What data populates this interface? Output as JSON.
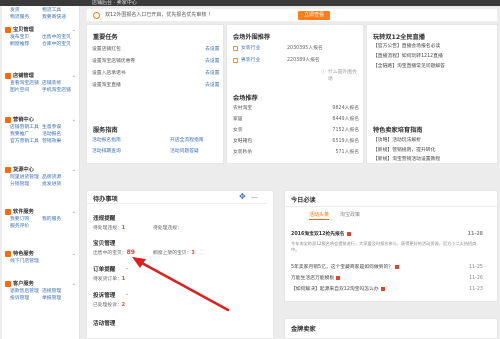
{
  "topbar": {
    "title": "店铺后台 · 卖家中心"
  },
  "sidebar": {
    "top_rows": [
      [
        "发货",
        "物流工具"
      ],
      [
        "物流服务",
        "我要寄快递"
      ]
    ],
    "groups": [
      {
        "title": "宝贝管理",
        "rows": [
          [
            "发布宝贝",
            "出售中的宝贝"
          ],
          [
            "橱窗推荐",
            "仓库中的宝贝"
          ]
        ]
      },
      {
        "title": "店铺管理",
        "rows": [
          [
            "查看淘宝店铺",
            "店铺装修"
          ],
          [
            "图片空间",
            "手机淘宝店铺"
          ]
        ]
      },
      {
        "title": "营销中心",
        "rows": [
          [
            "店铺营销工具",
            "生意参谋"
          ],
          [
            "我要推广",
            "活动报名"
          ],
          [
            "官方营销工具",
            "营销效果"
          ]
        ]
      },
      {
        "title": "货源中心",
        "rows": [
          [
            "阿里进货管理",
            "品牌货源"
          ],
          [
            "分销管理",
            "批发进货"
          ]
        ]
      },
      {
        "title": "软件服务",
        "rows": [
          [
            "我要订购",
            "我的服务"
          ],
          [
            "服务评价",
            ""
          ]
        ]
      },
      {
        "title": "特色服务",
        "rows": [
          [
            "线下门店管理",
            ""
          ]
        ]
      },
      {
        "title": "客户服务",
        "rows": [
          [
            "退款售后管理",
            "违规管理"
          ],
          [
            "投诉管理",
            "举报管理"
          ]
        ]
      }
    ]
  },
  "notice": {
    "text": "双12外围报名入口已开启，优先报名优先审核 ！",
    "button": "立即查看"
  },
  "tasks": {
    "title": "重要任务",
    "rows": [
      {
        "label": "设置店铺红包",
        "link": "去设置"
      },
      {
        "label": "设置淘宝店铺优惠券",
        "link": "去设置"
      },
      {
        "label": "设置入店承诺书",
        "link": "去设置"
      },
      {
        "label": "设置淘宝直播",
        "link": "去设置"
      }
    ]
  },
  "service": {
    "title": "服务指南",
    "rows": [
      {
        "left": "活动报名指南",
        "right": "开店全流程指南"
      },
      {
        "left": "活动排期查询",
        "right": "活动问题答疑"
      }
    ]
  },
  "venue": {
    "title": "会场外围推荐",
    "rows": [
      {
        "name": "女装行业",
        "count": "2030395人报名",
        "cat": ""
      },
      {
        "name": "男装行业",
        "count": "220389人报名",
        "cat": ""
      }
    ],
    "more": "什么是外围会场"
  },
  "venue_rec": {
    "title": "会场推荐",
    "rows": [
      {
        "name": "农村淘宝",
        "value": "9824人报名"
      },
      {
        "name": "家居",
        "value": "8449人报名"
      },
      {
        "name": "女装",
        "value": "7152人报名"
      },
      {
        "name": "女鞋箱包",
        "value": "6519人报名"
      },
      {
        "name": "女装秒杀",
        "value": "571人报名"
      }
    ]
  },
  "live": {
    "title": "玩转双12全民直播",
    "rows": [
      "【官方公告】直播会场报名必读",
      "【直播流程】如何玩转1212直播",
      "【全链路】淘宝直播常见问题解答"
    ]
  },
  "special": {
    "title": "特色卖家培育指南",
    "rows": [
      "【攻略】活动玩法解析",
      "【新规】营销规则，提升转化",
      "【新规】淘宝营销活动设置教程"
    ]
  },
  "todo": {
    "title": "待办事项",
    "sections": [
      {
        "title": "违规提醒",
        "items": [
          {
            "label": "待处理违规：",
            "value": "1"
          },
          {
            "label": "待处理违规：",
            "value": ""
          }
        ]
      },
      {
        "title": "宝贝管理",
        "items": [
          {
            "label": "出售中的宝贝：",
            "value": "89"
          },
          {
            "label": "橱窗上架的宝贝：",
            "value": "3"
          }
        ]
      },
      {
        "title": "订单提醒",
        "items": [
          {
            "label": "待发货订单：",
            "value": "1"
          }
        ]
      },
      {
        "title": "投诉管理",
        "items": [
          {
            "label": "已处理投诉：",
            "value": "2"
          }
        ]
      },
      {
        "title": "活动管理",
        "items": []
      }
    ]
  },
  "news": {
    "title": "今日必读",
    "tabs": [
      "活动头条",
      "淘宝政策"
    ],
    "headline": "2016淘宝双12抢先报名",
    "headline_date": "11-28",
    "summary": "今年淘宝的双12报名将会提前进行，大家要及时报名参与，获得更好的活动资源，官方小二火热招商中。",
    "rows": [
      {
        "text": "5年卖家月销5亿，这个宝藏商家是如何做到的？",
        "date": "11-25"
      },
      {
        "text": "万能生活店万能模板",
        "date": "11-26"
      },
      {
        "text": "【如何解决】起源来自双12淘宝吗怎么办",
        "date": "11-23"
      }
    ]
  },
  "bottom": {
    "title": "金牌卖家"
  }
}
